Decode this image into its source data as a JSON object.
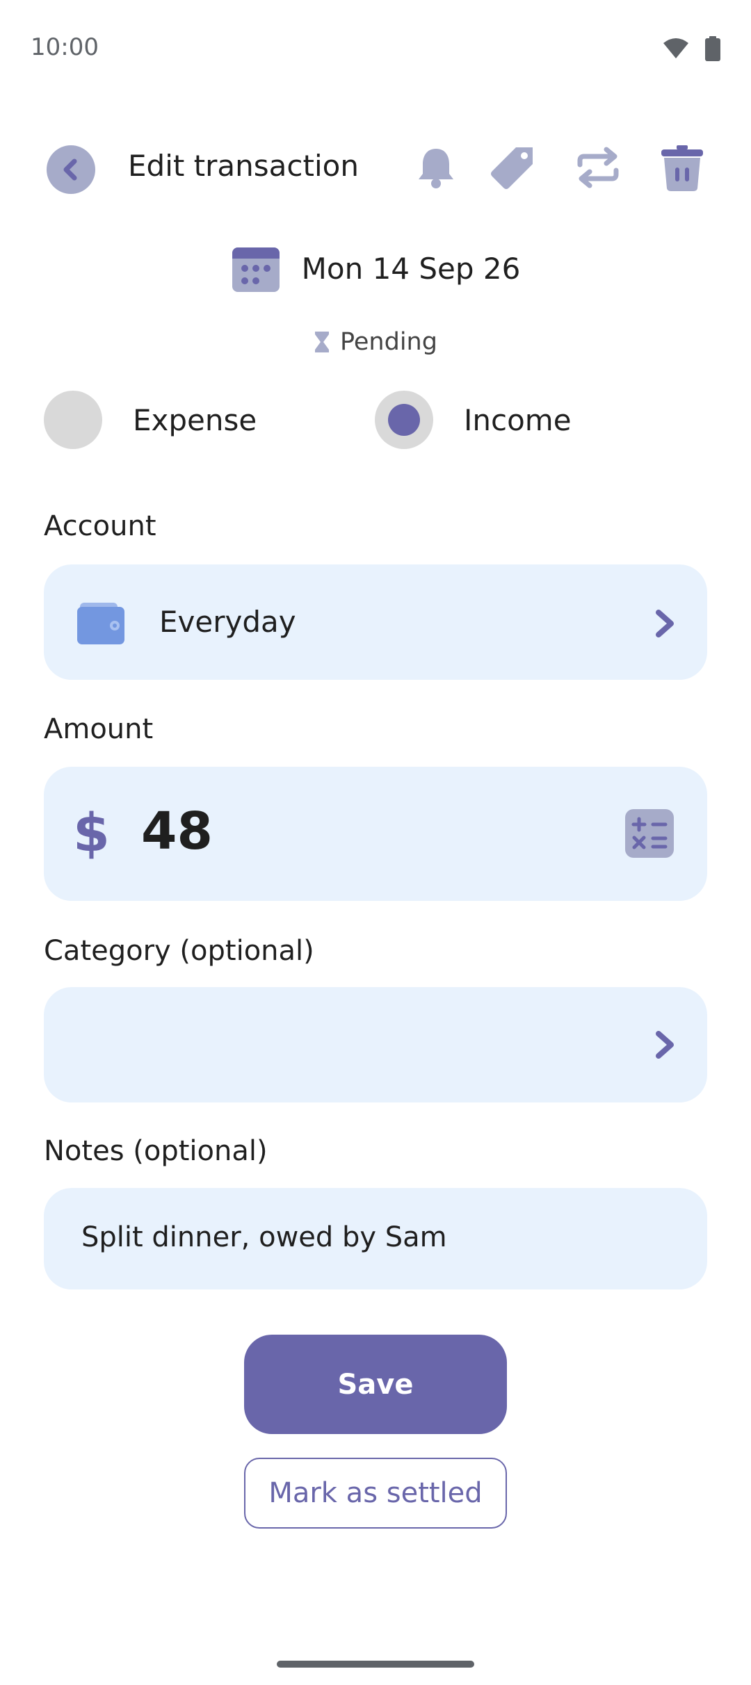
{
  "status_bar": {
    "time": "10:00"
  },
  "header": {
    "title": "Edit transaction",
    "icons": [
      "chevron-left-icon",
      "bell-icon",
      "tag-icon",
      "repeat-icon",
      "trash-icon"
    ]
  },
  "date": {
    "label": "Mon 14 Sep 26"
  },
  "status": {
    "label": "Pending"
  },
  "type_selector": {
    "options": [
      {
        "label": "Expense",
        "selected": false
      },
      {
        "label": "Income",
        "selected": true
      }
    ]
  },
  "account": {
    "section_label": "Account",
    "value": "Everyday"
  },
  "amount": {
    "section_label": "Amount",
    "currency_symbol": "$",
    "value": "48"
  },
  "category": {
    "section_label": "Category (optional)",
    "value": ""
  },
  "notes": {
    "section_label": "Notes (optional)",
    "value": "Split dinner, owed by Sam"
  },
  "actions": {
    "save_label": "Save",
    "settle_label": "Mark as settled"
  },
  "colors": {
    "accent": "#6966aa",
    "field_bg": "#e8f2fd",
    "icon_muted": "#a6abc9"
  }
}
